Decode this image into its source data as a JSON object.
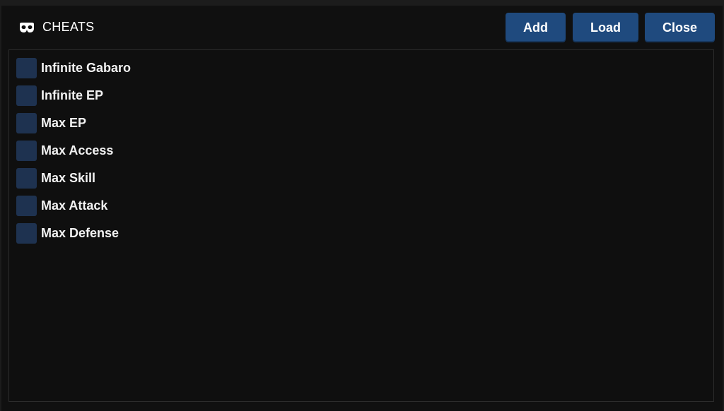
{
  "header": {
    "title": "CHEATS",
    "title_icon": "mask-icon"
  },
  "buttons": {
    "add_label": "Add",
    "load_label": "Load",
    "close_label": "Close"
  },
  "cheats": [
    {
      "label": "Infinite Gabaro",
      "checked": false
    },
    {
      "label": "Infinite EP",
      "checked": false
    },
    {
      "label": "Max EP",
      "checked": false
    },
    {
      "label": "Max Access",
      "checked": false
    },
    {
      "label": "Max Skill",
      "checked": false
    },
    {
      "label": "Max Attack",
      "checked": false
    },
    {
      "label": "Max Defense",
      "checked": false
    }
  ],
  "colors": {
    "button_bg": "#1f4a7e",
    "checkbox_bg": "#1e3250",
    "background": "#101010"
  }
}
